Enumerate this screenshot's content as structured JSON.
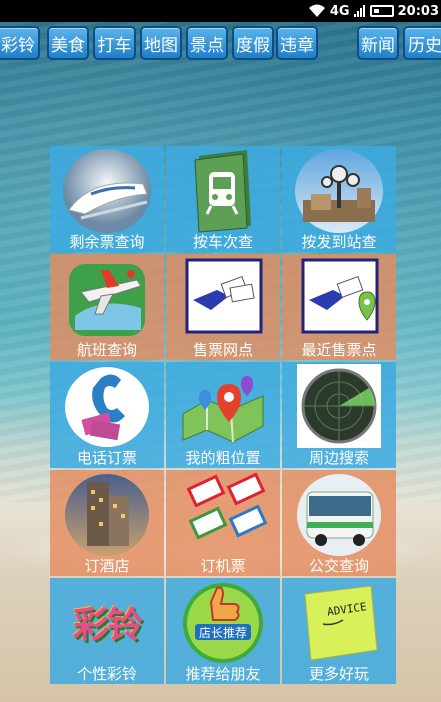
{
  "status_bar": {
    "network": "4G",
    "time": "20:03"
  },
  "tabs": [
    "彩铃",
    "美食",
    "打车",
    "地图",
    "景点",
    "度假",
    "违章",
    "新闻",
    "历史"
  ],
  "grid": [
    {
      "label": "剩余票查询",
      "icon": "bullet-train-icon",
      "color": "blue"
    },
    {
      "label": "按车次查",
      "icon": "train-folder-icon",
      "color": "blue"
    },
    {
      "label": "按发到站查",
      "icon": "station-clock-tower-icon",
      "color": "blue"
    },
    {
      "label": "航班查询",
      "icon": "airplane-map-icon",
      "color": "orange"
    },
    {
      "label": "售票网点",
      "icon": "hand-ticket-icon",
      "color": "orange"
    },
    {
      "label": "最近售票点",
      "icon": "hand-ticket-location-icon",
      "color": "orange"
    },
    {
      "label": "电话订票",
      "icon": "telephone-ticket-icon",
      "color": "blue"
    },
    {
      "label": "我的粗位置",
      "icon": "map-pins-icon",
      "color": "blue"
    },
    {
      "label": "周边搜索",
      "icon": "radar-icon",
      "color": "blue"
    },
    {
      "label": "订酒店",
      "icon": "hotel-building-icon",
      "color": "orange"
    },
    {
      "label": "订机票",
      "icon": "flight-tickets-icon",
      "color": "orange"
    },
    {
      "label": "公交查询",
      "icon": "bus-icon",
      "color": "orange"
    },
    {
      "label": "个性彩铃",
      "icon": "ringtone-icon",
      "color": "blue",
      "icon_text": "彩铃"
    },
    {
      "label": "推荐给朋友",
      "icon": "thumbs-up-icon",
      "color": "blue",
      "icon_text": "店长推荐"
    },
    {
      "label": "更多好玩",
      "icon": "sticky-note-icon",
      "color": "blue",
      "icon_text": "ADVICE"
    }
  ]
}
